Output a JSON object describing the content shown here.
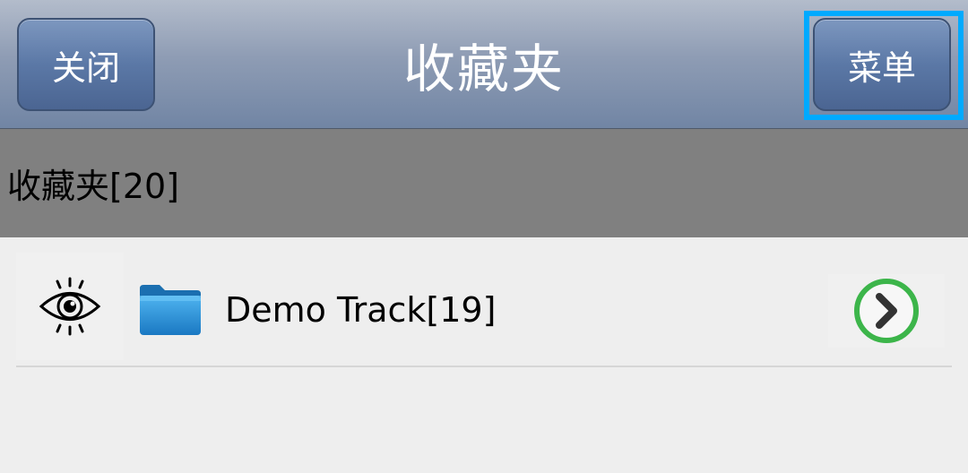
{
  "titlebar": {
    "title": "收藏夹",
    "close_label": "关闭",
    "menu_label": "菜单"
  },
  "group_header": {
    "label": "收藏夹[20]"
  },
  "list": {
    "items": [
      {
        "label": "Demo Track[19]",
        "visibility_icon": "eye-icon",
        "type_icon": "folder-icon",
        "action_icon": "chevron-right-circle-icon"
      }
    ]
  },
  "colors": {
    "highlight": "#00aaff",
    "arrow_green": "#3cb54a",
    "folder_blue": "#1e88d4"
  }
}
